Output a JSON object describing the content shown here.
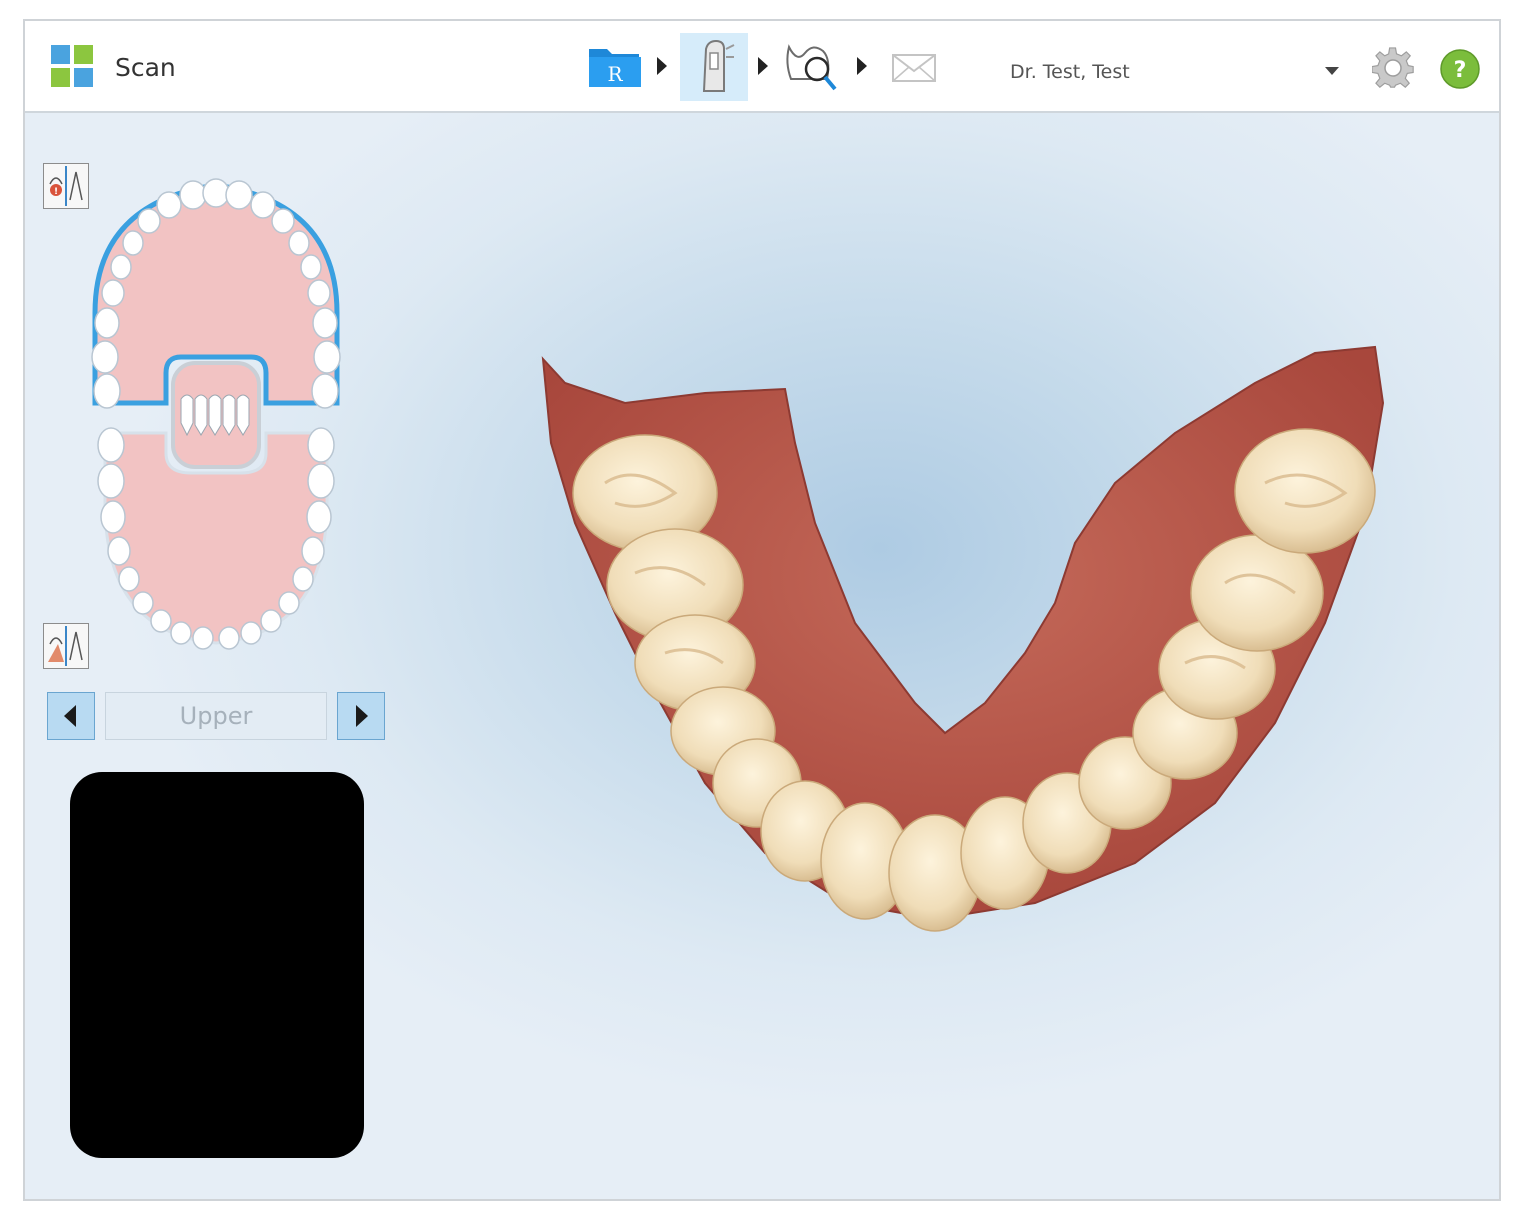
{
  "app": {
    "title": "Scan",
    "logo_icon": "app-grid-icon",
    "logo_colors": [
      "#4aa3df",
      "#8cc63f"
    ]
  },
  "workflow": {
    "steps": [
      {
        "icon": "rx-folder-icon",
        "letter": "R"
      },
      {
        "icon": "scan-wand-icon"
      },
      {
        "icon": "view-magnify-icon"
      },
      {
        "icon": "send-envelope-icon"
      }
    ],
    "active_step": 1,
    "accent": "#d6ecfa"
  },
  "user": {
    "name": "Dr. Test, Test",
    "dropdown_icon": "chevron-down-icon"
  },
  "actions": {
    "settings_icon": "gear-icon",
    "help_icon": "help-icon",
    "help_glyph": "?",
    "help_color": "#7bbd3c"
  },
  "scan_panel": {
    "jaw_selector": {
      "label": "Upper",
      "prev_icon": "arrow-left-icon",
      "next_icon": "arrow-right-icon"
    },
    "upper_tool_icon": "missing-area-icon",
    "lower_tool_icon": "trim-tool-icon",
    "camera_icon": "camera-preview"
  },
  "colors": {
    "arch_outline": "#3aa0e0",
    "gum_pink": "#f2c3c3",
    "tooth_white": "#ffffff"
  }
}
